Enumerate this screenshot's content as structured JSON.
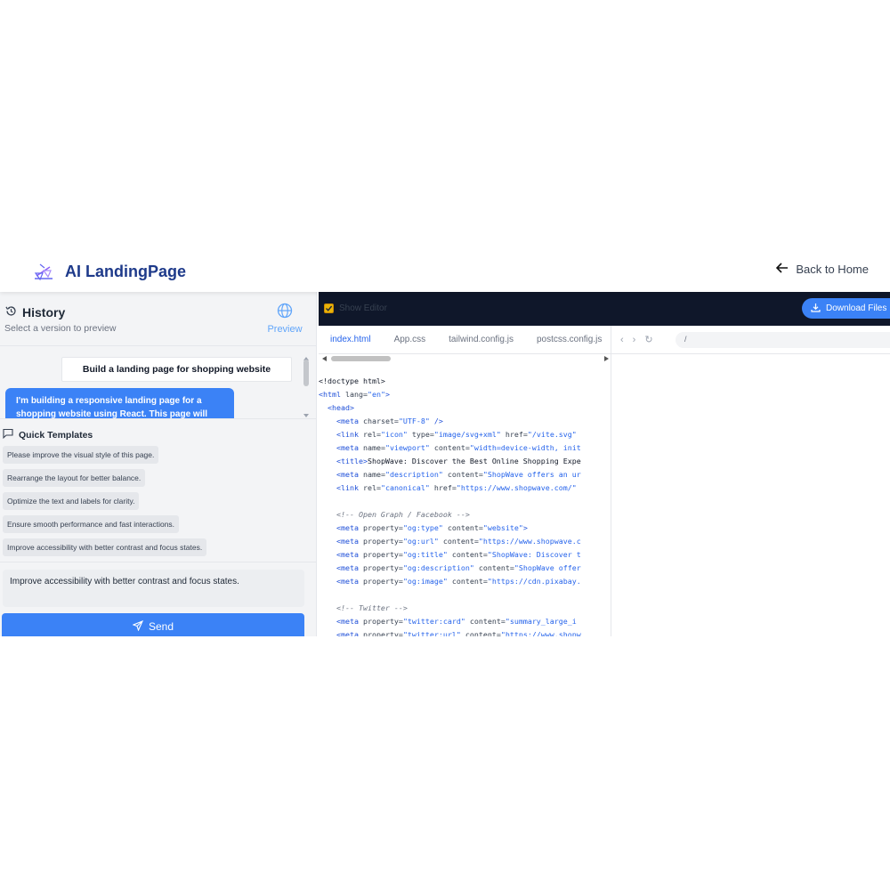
{
  "header": {
    "brand": "AI LandingPage",
    "back_label": "Back to Home"
  },
  "history": {
    "title": "History",
    "subtitle": "Select a version to preview",
    "preview_label": "Preview"
  },
  "chat": {
    "user_message": "Build a landing page for shopping website",
    "ai_message": "I'm building a responsive landing page for a shopping website using React. This page will"
  },
  "templates": {
    "title": "Quick Templates",
    "items": [
      "Please improve the visual style of this page.",
      "Rearrange the layout for better balance.",
      "Optimize the text and labels for clarity.",
      "Ensure smooth performance and fast interactions.",
      "Improve accessibility with better contrast and focus states."
    ]
  },
  "composer": {
    "value": "Improve accessibility with better contrast and focus states.",
    "send_label": "Send"
  },
  "editor": {
    "toggle_label": "Show Editor",
    "download_label": "Download Files",
    "tabs": [
      "index.html",
      "App.css",
      "tailwind.config.js",
      "postcss.config.js"
    ],
    "active_tab": "index.html"
  },
  "browser": {
    "url": "/"
  },
  "code_lines": [
    [
      [
        "plain",
        "<!doctype html>"
      ]
    ],
    [
      [
        "tag",
        "<html "
      ],
      [
        "attr",
        "lang="
      ],
      [
        "str",
        "\"en\""
      ],
      [
        "tag",
        ">"
      ]
    ],
    [
      [
        "plain",
        "  "
      ],
      [
        "tag",
        "<head>"
      ]
    ],
    [
      [
        "plain",
        "    "
      ],
      [
        "tag",
        "<meta "
      ],
      [
        "attr",
        "charset="
      ],
      [
        "str",
        "\"UTF-8\""
      ],
      [
        "tag",
        " />"
      ]
    ],
    [
      [
        "plain",
        "    "
      ],
      [
        "tag",
        "<link "
      ],
      [
        "attr",
        "rel="
      ],
      [
        "str",
        "\"icon\""
      ],
      [
        "attr",
        " type="
      ],
      [
        "str",
        "\"image/svg+xml\""
      ],
      [
        "attr",
        " href="
      ],
      [
        "str",
        "\"/vite.svg\""
      ]
    ],
    [
      [
        "plain",
        "    "
      ],
      [
        "tag",
        "<meta "
      ],
      [
        "attr",
        "name="
      ],
      [
        "str",
        "\"viewport\""
      ],
      [
        "attr",
        " content="
      ],
      [
        "str",
        "\"width=device-width, init"
      ]
    ],
    [
      [
        "plain",
        "    "
      ],
      [
        "tag",
        "<title>"
      ],
      [
        "plain",
        "ShopWave: Discover the Best Online Shopping Expe"
      ]
    ],
    [
      [
        "plain",
        "    "
      ],
      [
        "tag",
        "<meta "
      ],
      [
        "attr",
        "name="
      ],
      [
        "str",
        "\"description\""
      ],
      [
        "attr",
        " content="
      ],
      [
        "str",
        "\"ShopWave offers an ur"
      ]
    ],
    [
      [
        "plain",
        "    "
      ],
      [
        "tag",
        "<link "
      ],
      [
        "attr",
        "rel="
      ],
      [
        "str",
        "\"canonical\""
      ],
      [
        "attr",
        " href="
      ],
      [
        "str",
        "\"https://www.shopwave.com/\""
      ]
    ],
    [
      [
        "plain",
        ""
      ]
    ],
    [
      [
        "plain",
        "    "
      ],
      [
        "cmt",
        "<!-- Open Graph / Facebook -->"
      ]
    ],
    [
      [
        "plain",
        "    "
      ],
      [
        "tag",
        "<meta "
      ],
      [
        "attr",
        "property="
      ],
      [
        "str",
        "\"og:type\""
      ],
      [
        "attr",
        " content="
      ],
      [
        "str",
        "\"website\""
      ],
      [
        "tag",
        ">"
      ]
    ],
    [
      [
        "plain",
        "    "
      ],
      [
        "tag",
        "<meta "
      ],
      [
        "attr",
        "property="
      ],
      [
        "str",
        "\"og:url\""
      ],
      [
        "attr",
        " content="
      ],
      [
        "str",
        "\"https://www.shopwave.c"
      ]
    ],
    [
      [
        "plain",
        "    "
      ],
      [
        "tag",
        "<meta "
      ],
      [
        "attr",
        "property="
      ],
      [
        "str",
        "\"og:title\""
      ],
      [
        "attr",
        " content="
      ],
      [
        "str",
        "\"ShopWave: Discover t"
      ]
    ],
    [
      [
        "plain",
        "    "
      ],
      [
        "tag",
        "<meta "
      ],
      [
        "attr",
        "property="
      ],
      [
        "str",
        "\"og:description\""
      ],
      [
        "attr",
        " content="
      ],
      [
        "str",
        "\"ShopWave offer"
      ]
    ],
    [
      [
        "plain",
        "    "
      ],
      [
        "tag",
        "<meta "
      ],
      [
        "attr",
        "property="
      ],
      [
        "str",
        "\"og:image\""
      ],
      [
        "attr",
        " content="
      ],
      [
        "str",
        "\"https://cdn.pixabay."
      ]
    ],
    [
      [
        "plain",
        ""
      ]
    ],
    [
      [
        "plain",
        "    "
      ],
      [
        "cmt",
        "<!-- Twitter -->"
      ]
    ],
    [
      [
        "plain",
        "    "
      ],
      [
        "tag",
        "<meta "
      ],
      [
        "attr",
        "property="
      ],
      [
        "str",
        "\"twitter:card\""
      ],
      [
        "attr",
        " content="
      ],
      [
        "str",
        "\"summary_large_i"
      ]
    ],
    [
      [
        "plain",
        "    "
      ],
      [
        "tag",
        "<meta "
      ],
      [
        "attr",
        "property="
      ],
      [
        "str",
        "\"twitter:url\""
      ],
      [
        "attr",
        " content="
      ],
      [
        "str",
        "\"https://www.shopw"
      ]
    ]
  ],
  "colors": {
    "accent": "#3b82f6",
    "brand": "#1e3a8a",
    "editor_bar": "#0f172a"
  }
}
